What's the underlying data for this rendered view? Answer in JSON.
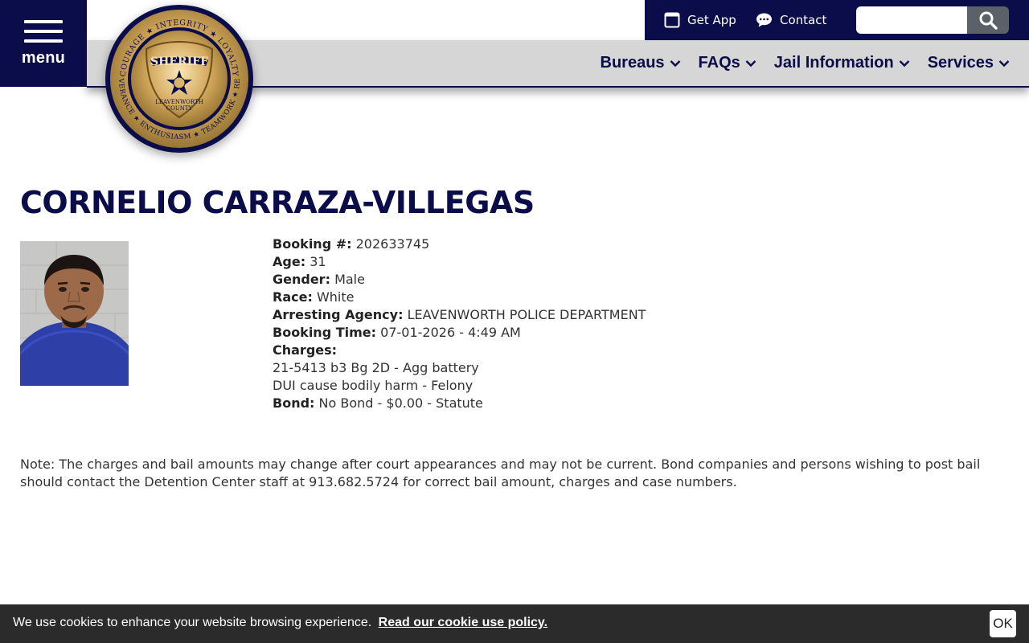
{
  "header": {
    "menu_label": "menu",
    "utility": {
      "get_app_label": "Get App",
      "contact_label": "Contact",
      "search_value": ""
    },
    "nav": [
      {
        "label": "Bureaus"
      },
      {
        "label": "FAQs"
      },
      {
        "label": "Jail Information"
      },
      {
        "label": "Services"
      }
    ],
    "seal": {
      "ring_text_top": "COURAGE ★ INTEGRITY ★ LOYALTY",
      "ring_text_bottom": "PERSEVERANCE ★ ENTHUSIASM ★ TEAMWORK ★ RESPECT",
      "badge_title": "SHERIFF",
      "badge_county": "LEAVENWORTH",
      "badge_county2": "COUNTY"
    }
  },
  "inmate": {
    "name": "CORNELIO CARRAZA-VILLEGAS",
    "booking_label": "Booking #:",
    "booking_number": "202633745",
    "age_label": "Age:",
    "age": "31",
    "gender_label": "Gender:",
    "gender": "Male",
    "race_label": "Race:",
    "race": "White",
    "agency_label": "Arresting Agency:",
    "agency": "LEAVENWORTH POLICE DEPARTMENT",
    "booking_time_label": "Booking Time:",
    "booking_time": "07-01-2026 - 4:49 AM",
    "charges_label": "Charges:",
    "charges": [
      "21-5413 b3 Bg 2D - Agg battery",
      "DUI cause bodily harm - Felony"
    ],
    "bond_label": "Bond:",
    "bond": "No Bond - $0.00 - Statute"
  },
  "note": "Note: The charges and bail amounts may change after court appearances and may not be current. Bond companies and persons wishing to post bail should contact the Detention Center staff at 913.682.5724 for correct bail amount, charges and case numbers.",
  "cookie": {
    "text": "We use cookies to enhance your website browsing experience.",
    "link_label": "Read our cookie use policy.",
    "ok_label": "OK"
  },
  "colors": {
    "navy": "#0b0d4a",
    "nav_gray": "#d6d6d6",
    "cookie_bg": "#2b2b2b",
    "search_btn": "#5b6169",
    "seal_gold": "#c8a15a"
  },
  "icons": {
    "menu": "hamburger-icon",
    "get_app": "mobile-app-icon",
    "contact": "chat-bubble-icon",
    "search": "search-icon",
    "nav_dropdown": "chevron-down-icon"
  }
}
